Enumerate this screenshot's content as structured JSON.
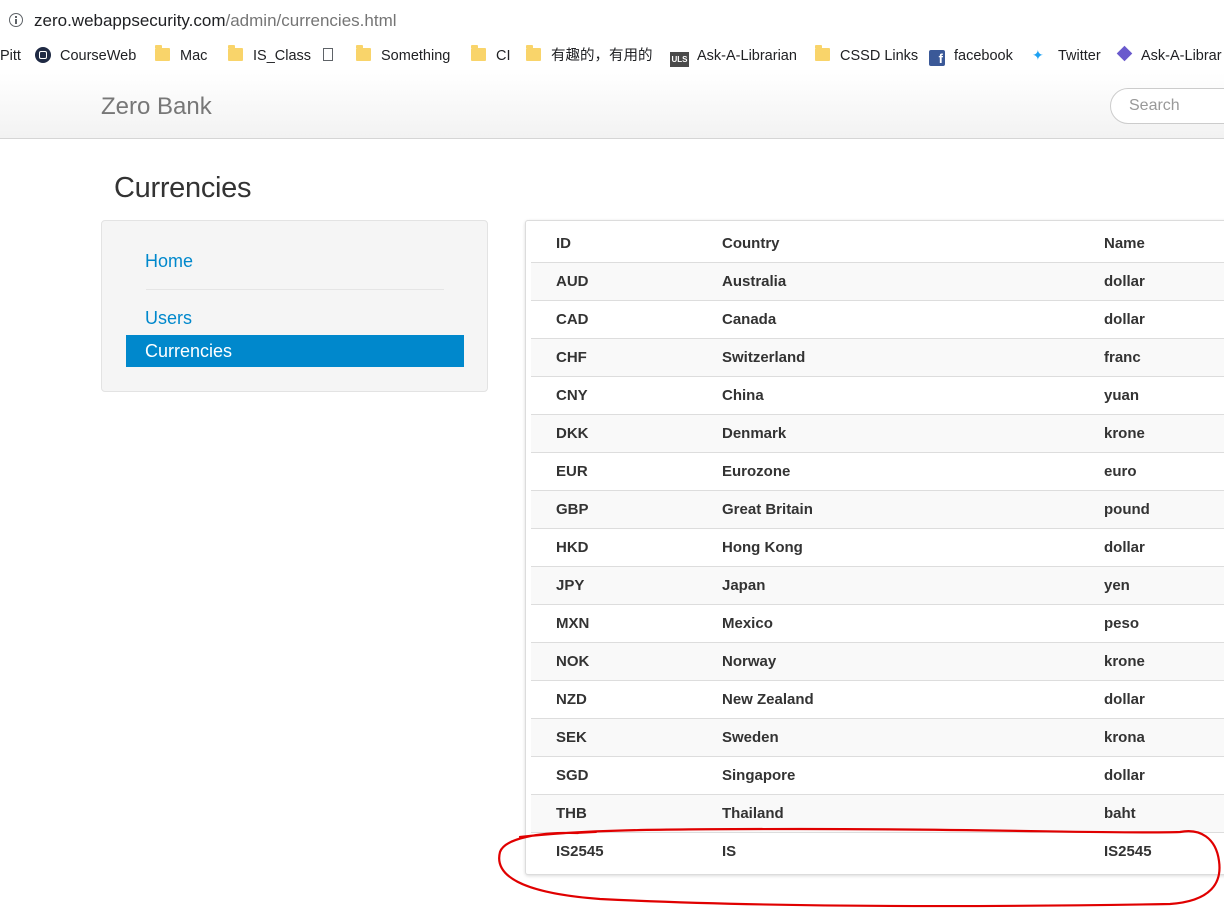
{
  "browser": {
    "url_host": "zero.webappsecurity.com",
    "url_path": "/admin/currencies.html",
    "bookmarks": [
      "Pitt",
      "CourseWeb",
      "Mac",
      "IS_Class",
      "Something",
      "CI",
      "有趣的，有用的",
      "Ask-A-Librarian",
      "CSSD Links",
      "facebook",
      "Twitter",
      "Ask-A-Librar"
    ],
    "uls_icon_text": "ULS"
  },
  "navbar": {
    "brand": "Zero Bank",
    "search_placeholder": "Search"
  },
  "page": {
    "title": "Currencies"
  },
  "sidebar": {
    "items": [
      {
        "label": "Home"
      },
      {
        "label": "Users"
      },
      {
        "label": "Currencies"
      }
    ]
  },
  "table": {
    "headers": [
      "ID",
      "Country",
      "Name"
    ],
    "rows": [
      [
        "AUD",
        "Australia",
        "dollar"
      ],
      [
        "CAD",
        "Canada",
        "dollar"
      ],
      [
        "CHF",
        "Switzerland",
        "franc"
      ],
      [
        "CNY",
        "China",
        "yuan"
      ],
      [
        "DKK",
        "Denmark",
        "krone"
      ],
      [
        "EUR",
        "Eurozone",
        "euro"
      ],
      [
        "GBP",
        "Great Britain",
        "pound"
      ],
      [
        "HKD",
        "Hong Kong",
        "dollar"
      ],
      [
        "JPY",
        "Japan",
        "yen"
      ],
      [
        "MXN",
        "Mexico",
        "peso"
      ],
      [
        "NOK",
        "Norway",
        "krone"
      ],
      [
        "NZD",
        "New Zealand",
        "dollar"
      ],
      [
        "SEK",
        "Sweden",
        "krona"
      ],
      [
        "SGD",
        "Singapore",
        "dollar"
      ],
      [
        "THB",
        "Thailand",
        "baht"
      ],
      [
        "IS2545",
        "IS",
        "IS2545"
      ]
    ]
  },
  "annotation": {
    "color": "#e00000"
  }
}
